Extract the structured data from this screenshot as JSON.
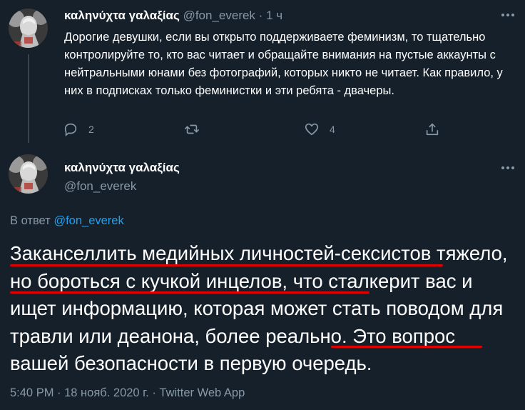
{
  "tweet": {
    "author_name": "καληνύχτα γαλαξίας",
    "handle": "@fon_everek",
    "separator": "·",
    "time_ago": "1 ч",
    "text": "Дорогие девушки, если вы открыто поддерживаете феминизм, то тщательно контролируйте то, кто вас читает и обращайте внимания на пустые аккаунты с нейтральными юнами без фотографий, которых никто не читает. Как правило, у них в подписках только феминистки и эти ребята - двачеры.",
    "replies_count": "2",
    "retweets_count": "",
    "likes_count": "4"
  },
  "reply": {
    "author_name": "καληνύχτα γαλαξίας",
    "handle": "@fon_everek",
    "reply_prefix": "В ответ",
    "reply_handle": "@fon_everek",
    "text": "Заканселлить медийных личностей-сексистов тяжело, но бороться с кучкой инцелов, что сталкерит вас и ищет информацию, которая может стать поводом для травли или деанона, более реально. Это вопрос вашей безопасности в первую очередь.",
    "timestamp": "5:40 PM · 18 нояб. 2020 г. · Twitter Web App"
  },
  "colors": {
    "background": "#15202b",
    "secondary_text": "#8899a6",
    "link": "#1da1f2",
    "underline": "#e00000"
  },
  "icons": [
    "more-icon",
    "reply-icon",
    "retweet-icon",
    "like-icon",
    "share-icon"
  ]
}
